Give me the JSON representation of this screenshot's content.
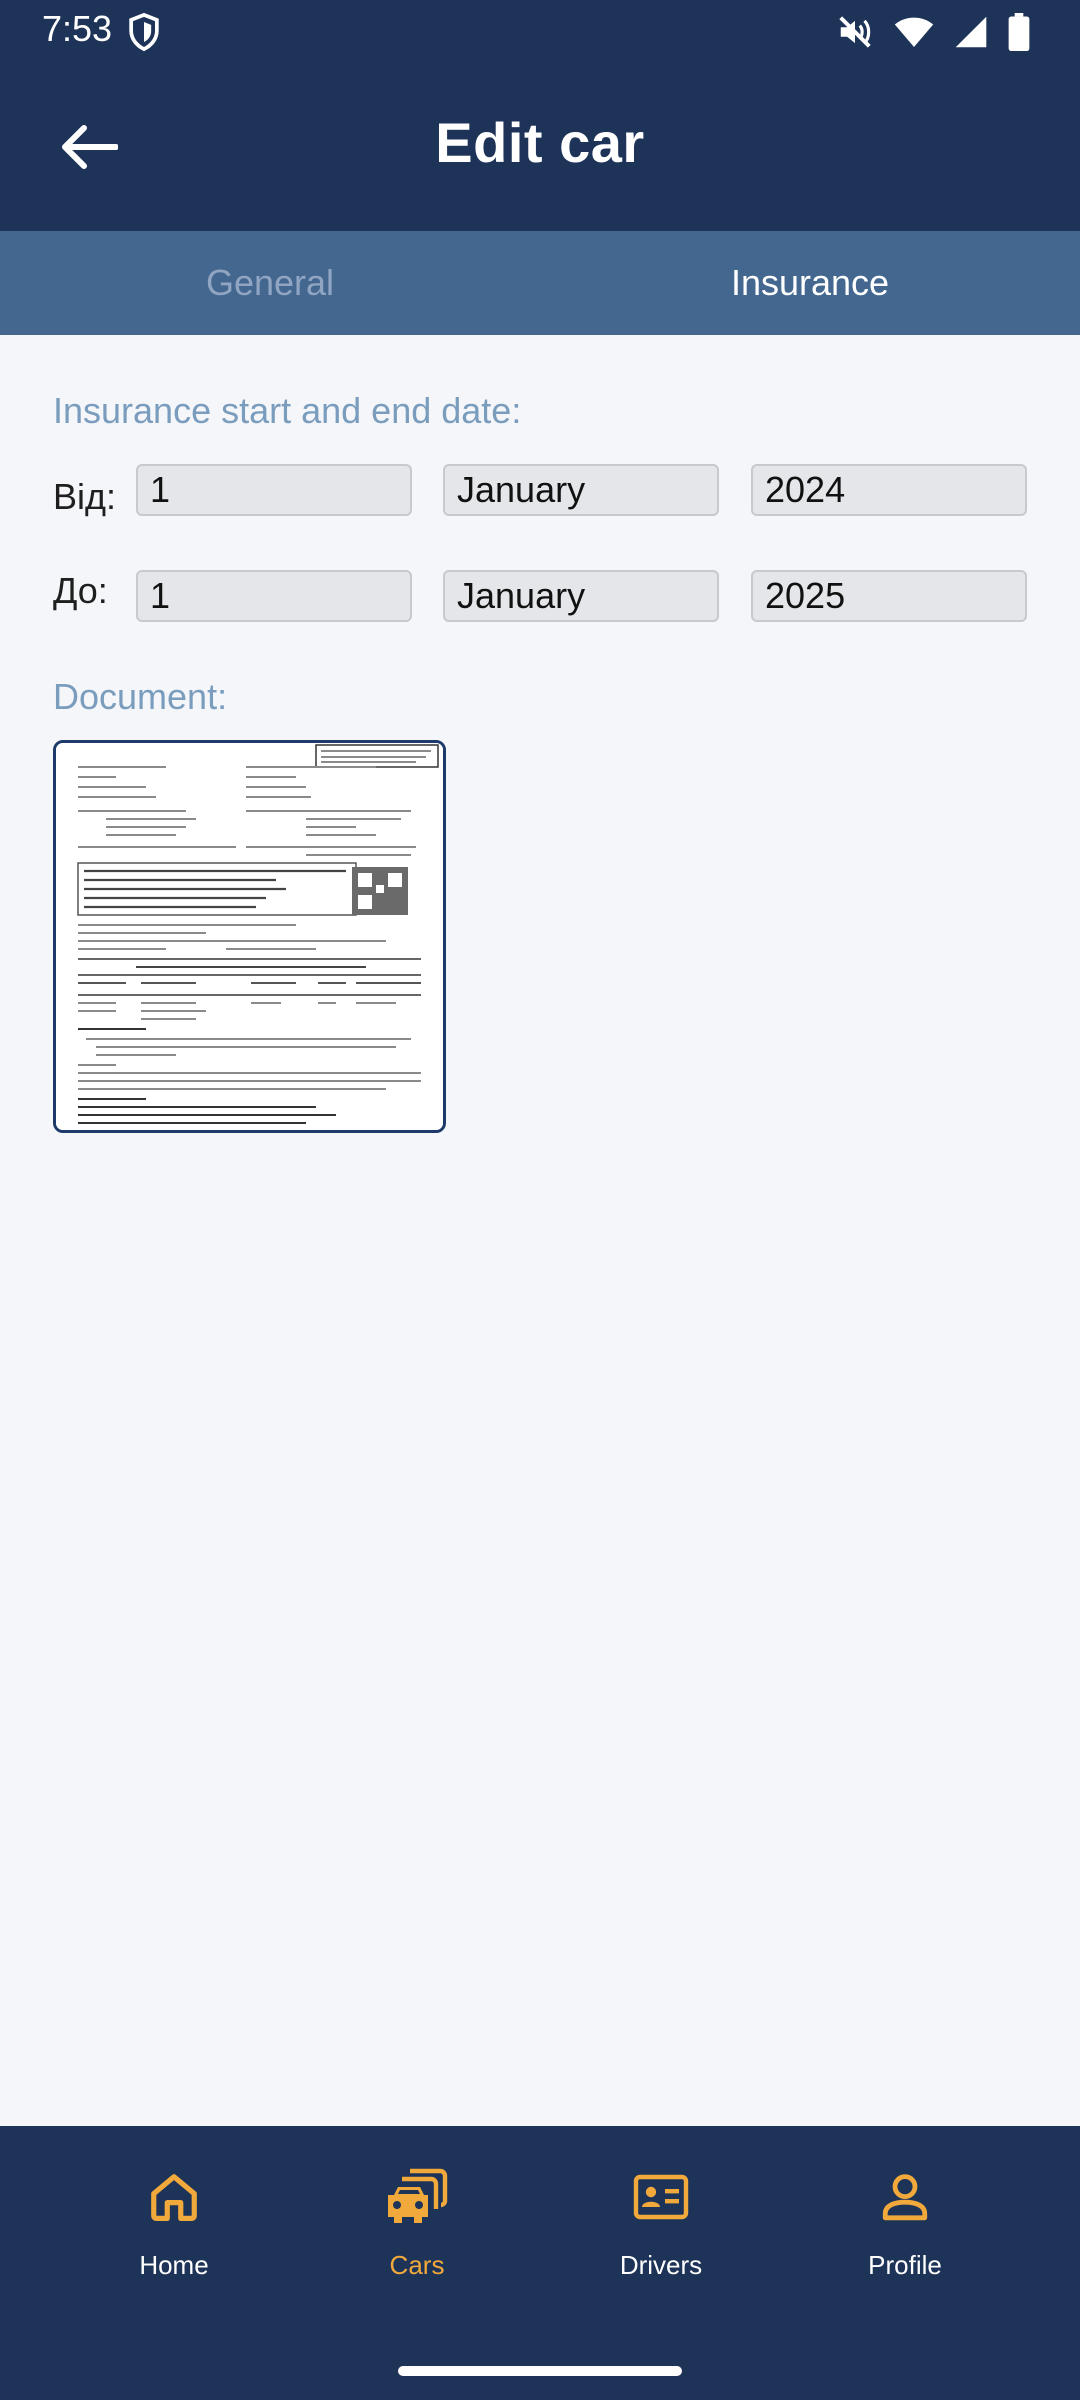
{
  "status_bar": {
    "time": "7:53",
    "icons": [
      "shield-icon",
      "mute-icon",
      "wifi-icon",
      "signal-icon",
      "battery-icon"
    ]
  },
  "header": {
    "title": "Edit car",
    "back_icon": "arrow-left-icon"
  },
  "tabs": [
    {
      "label": "General",
      "selected": false
    },
    {
      "label": "Insurance",
      "selected": true
    }
  ],
  "insurance": {
    "section_label": "Insurance start and end date:",
    "from": {
      "label": "Від:",
      "day": "1",
      "month": "January",
      "year": "2024"
    },
    "to": {
      "label": "До:",
      "day": "1",
      "month": "January",
      "year": "2025"
    }
  },
  "document": {
    "section_label": "Document:",
    "thumbnail": "insurance-policy-document-image"
  },
  "bottom_nav": {
    "items": [
      {
        "label": "Home",
        "icon": "home-icon",
        "active": false
      },
      {
        "label": "Cars",
        "icon": "cars-icon",
        "active": true
      },
      {
        "label": "Drivers",
        "icon": "id-card-icon",
        "active": false
      },
      {
        "label": "Profile",
        "icon": "person-icon",
        "active": false
      }
    ]
  },
  "colors": {
    "header_bg": "#1e3358",
    "tab_bar_bg": "#44678f",
    "section_label": "#7a9cbd",
    "accent": "#f2a93b"
  }
}
